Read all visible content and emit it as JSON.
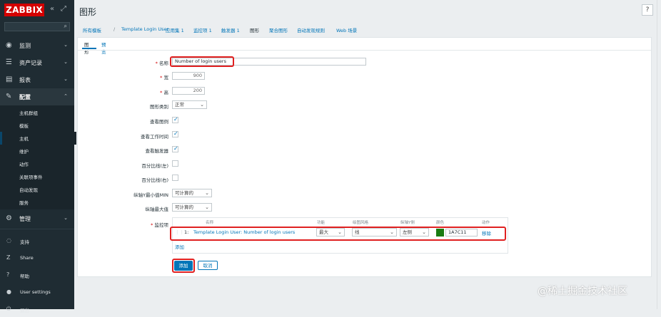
{
  "sidebar": {
    "logo": "ZABBIX",
    "collapse_icon": "double-chevron-left-icon",
    "kiosk_icon": "kiosk-icon",
    "search_placeholder": "",
    "menu": [
      {
        "label": "监测",
        "icon": "eye-icon"
      },
      {
        "label": "资产记录",
        "icon": "list-icon"
      },
      {
        "label": "报表",
        "icon": "report-icon"
      },
      {
        "label": "配置",
        "icon": "wrench-icon"
      },
      {
        "label": "管理",
        "icon": "gear-icon"
      }
    ],
    "config_sub": [
      "主机群组",
      "模板",
      "主机",
      "维护",
      "动作",
      "关联项事件",
      "自动发现",
      "服务"
    ],
    "bottom": [
      {
        "label": "支持",
        "icon": "support-icon"
      },
      {
        "label": "Share",
        "icon": "share-icon"
      },
      {
        "label": "帮助",
        "icon": "help-icon"
      },
      {
        "label": "User settings",
        "icon": "user-icon"
      },
      {
        "label": "退出",
        "icon": "signout-icon"
      }
    ]
  },
  "header": {
    "title": "图形",
    "help_icon": "?"
  },
  "breadcrumb": {
    "items": [
      "所有模板",
      "Template Login User",
      "应用集 1",
      "监控项 1",
      "触发器 1",
      "图形",
      "聚合图形",
      "自动发现规则",
      "Web 场景"
    ]
  },
  "subtabs": [
    "图形",
    "预览"
  ],
  "form": {
    "name_label": "名称",
    "name_value": "Number of login users",
    "width_label": "宽",
    "width_value": "900",
    "height_label": "高",
    "height_value": "200",
    "graph_type_label": "图形类别",
    "graph_type_value": "正常",
    "show_legend_label": "查看图例",
    "show_working_time_label": "查看工作时间",
    "show_triggers_label": "查看触发器",
    "percentile_left_label": "百分比线(左)",
    "percentile_right_label": "百分比线(右)",
    "ymin_label": "纵轴Y最小值MIN",
    "ymin_value": "可计算的",
    "ymax_label": "纵轴最大值",
    "ymax_value": "可计算的",
    "items_label": "监控项"
  },
  "items_table": {
    "headers": [
      "名称",
      "功能",
      "绘图风格",
      "纵轴Y侧",
      "颜色",
      "动作"
    ],
    "rows": [
      {
        "index": "1:",
        "name": "Template Login User: Number of login users",
        "function": "最大",
        "draw_style": "线",
        "y_side": "左侧",
        "color": "1A7C11",
        "color_hex": "#1a7c11",
        "action": "移除"
      }
    ],
    "add_link": "添加"
  },
  "buttons": {
    "add": "添加",
    "cancel": "取消"
  },
  "watermark": "@稀土掘金技术社区"
}
